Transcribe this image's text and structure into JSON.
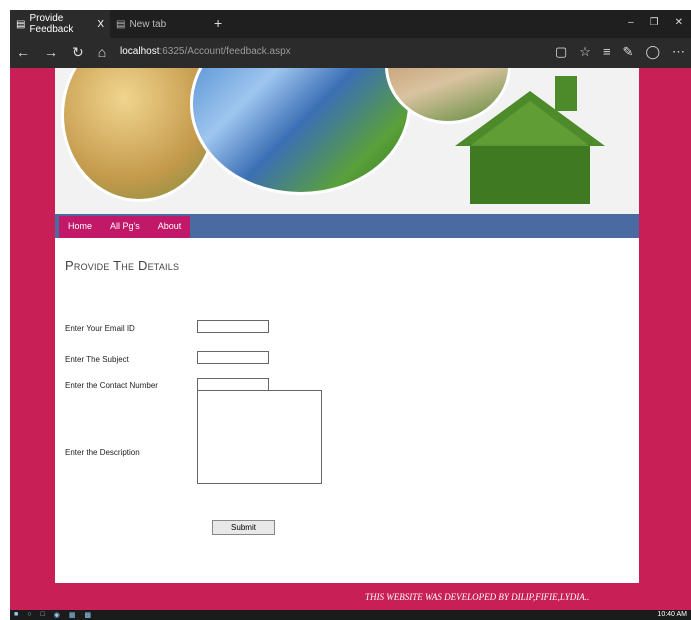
{
  "browser": {
    "tabs": [
      {
        "label": "Provide Feedback",
        "close": "X"
      },
      {
        "label": "New tab"
      }
    ],
    "new_tab": "+",
    "url_host": "localhost",
    "url_path": ":6325/Account/feedback.aspx"
  },
  "site": {
    "menu": [
      "Home",
      "All Pg's",
      "About"
    ],
    "heading": "Provide The Details",
    "form": {
      "email_label": "Enter Your Email ID",
      "subject_label": "Enter The Subject",
      "contact_label": "Enter the Contact Number",
      "description_label": "Enter the Description",
      "submit_label": "Submit"
    },
    "footer": "THIS WEBSITE WAS DEVELOPED BY DILIP,FIFIE,LYDIA.."
  },
  "taskbar": {
    "clock": "10:40 AM"
  },
  "colors": {
    "accent": "#c2186a",
    "menubar": "#4a6aa2",
    "background": "#c71f56"
  }
}
